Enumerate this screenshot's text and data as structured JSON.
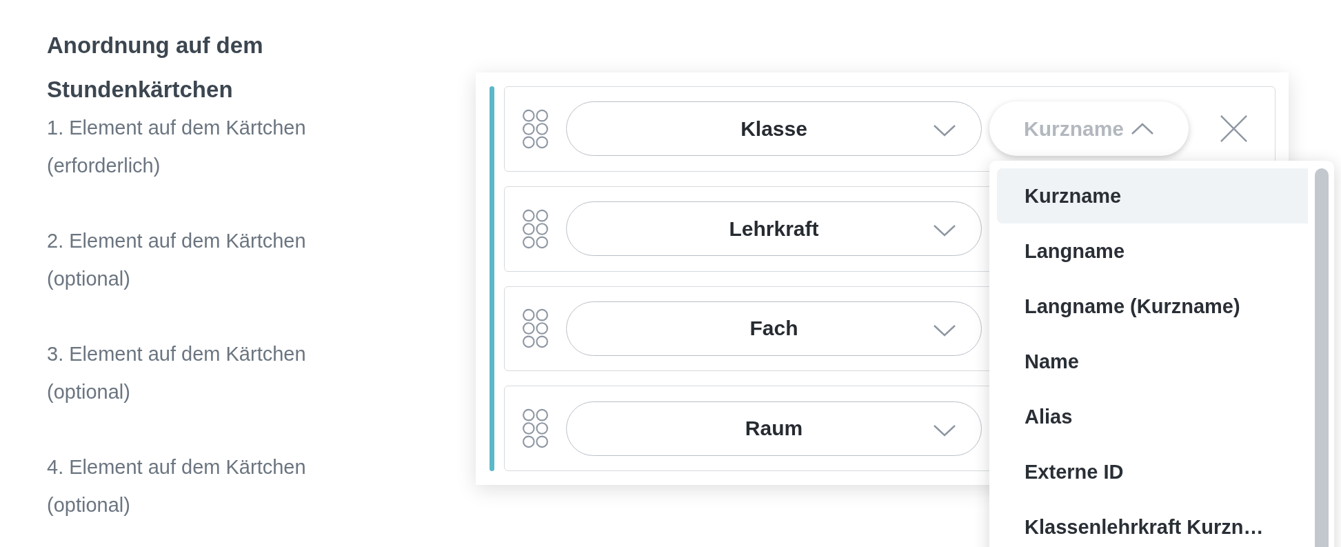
{
  "section": {
    "title": "Anordnung auf dem Stundenkärtchen",
    "labels": [
      "1. Element auf dem Kärtchen (erforderlich)",
      "2. Element auf dem Kärtchen (optional)",
      "3. Element auf dem Kärtchen (optional)",
      "4. Element auf dem Kärtchen (optional)"
    ]
  },
  "rows": [
    {
      "value": "Klasse",
      "format": {
        "value": "Kurzname",
        "expanded": true
      }
    },
    {
      "value": "Lehrkraft"
    },
    {
      "value": "Fach"
    },
    {
      "value": "Raum"
    }
  ],
  "dropdown": {
    "options": [
      {
        "label": "Kurzname",
        "selected": true
      },
      {
        "label": "Langname",
        "selected": false
      },
      {
        "label": "Langname (Kurzname)",
        "selected": false
      },
      {
        "label": "Name",
        "selected": false
      },
      {
        "label": "Alias",
        "selected": false
      },
      {
        "label": "Externe ID",
        "selected": false
      },
      {
        "label": "Klassenlehrkraft Kurzn…",
        "selected": false
      }
    ]
  }
}
